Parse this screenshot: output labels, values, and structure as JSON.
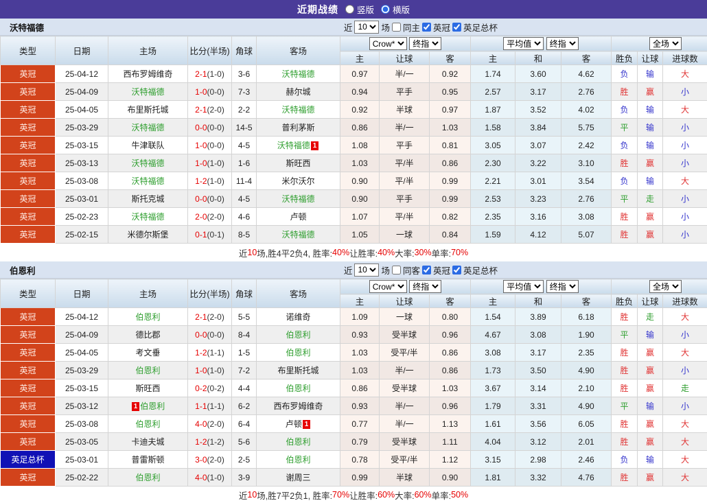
{
  "title_bar": {
    "title": "近期战绩",
    "vertical": "竖版",
    "horizontal": "横版"
  },
  "colors": {
    "titlebar_purple": "#4a3c99",
    "league_orange": "#d2431b",
    "cup_blue": "#1111b5",
    "focal_team_green": "#2e9e2e",
    "score_red": "#e60000",
    "win_red": "#e03333",
    "loss_blue": "#3333cc",
    "draw_green": "#2e9e2e"
  },
  "type_styles": {
    "英冠": "league",
    "英足总杯": "cup"
  },
  "value_colors": {
    "胜": "red",
    "赢": "red",
    "大": "red",
    "负": "blue",
    "输": "blue",
    "小": "blue",
    "平": "green",
    "走": "green"
  },
  "table_header": {
    "type": "类型",
    "date": "日期",
    "home": "主场",
    "score": "比分(半场)",
    "corners": "角球",
    "away": "客场",
    "h_home": "主",
    "h_hcp": "让球",
    "h_away": "客",
    "a_home": "主",
    "a_draw": "和",
    "a_away": "客",
    "r_wl": "胜负",
    "r_hcp": "让球",
    "r_goals": "进球数"
  },
  "sections": [
    {
      "team": "沃特福德",
      "filter": {
        "near": "近",
        "count": "10",
        "matches": "场",
        "same": "同主",
        "league1": "英冠",
        "league2": "英足总杯"
      },
      "selects": {
        "source": "Crow*",
        "time1": "终指",
        "avg": "平均值",
        "time2": "终指",
        "scope": "全场"
      },
      "rows": [
        {
          "type": "英冠",
          "date": "25-04-12",
          "home": "西布罗姆维奇",
          "score": "2-1",
          "half": "(1-0)",
          "corners": "3-6",
          "away": "沃特福德",
          "ag": 1,
          "o1": "0.97",
          "hcp": "半/一",
          "o2": "0.92",
          "a1": "1.74",
          "a2": "3.60",
          "a3": "4.62",
          "r": "负",
          "hr": "输",
          "g": "大"
        },
        {
          "type": "英冠",
          "date": "25-04-09",
          "home": "沃特福德",
          "hg": 1,
          "score": "1-0",
          "half": "(0-0)",
          "corners": "7-3",
          "away": "赫尔城",
          "o1": "0.94",
          "hcp": "平手",
          "o2": "0.95",
          "a1": "2.57",
          "a2": "3.17",
          "a3": "2.76",
          "r": "胜",
          "hr": "赢",
          "g": "小"
        },
        {
          "type": "英冠",
          "date": "25-04-05",
          "home": "布里斯托城",
          "score": "2-1",
          "half": "(2-0)",
          "corners": "2-2",
          "away": "沃特福德",
          "ag": 1,
          "o1": "0.92",
          "hcp": "半球",
          "o2": "0.97",
          "a1": "1.87",
          "a2": "3.52",
          "a3": "4.02",
          "r": "负",
          "hr": "输",
          "g": "大"
        },
        {
          "type": "英冠",
          "date": "25-03-29",
          "home": "沃特福德",
          "hg": 1,
          "score": "0-0",
          "half": "(0-0)",
          "corners": "14-5",
          "away": "普利茅斯",
          "o1": "0.86",
          "hcp": "半/一",
          "o2": "1.03",
          "a1": "1.58",
          "a2": "3.84",
          "a3": "5.75",
          "r": "平",
          "hr": "输",
          "g": "小"
        },
        {
          "type": "英冠",
          "date": "25-03-15",
          "home": "牛津联队",
          "score": "1-0",
          "half": "(0-0)",
          "corners": "4-5",
          "away": "沃特福德",
          "ag": 1,
          "aba": "1",
          "o1": "1.08",
          "hcp": "平手",
          "o2": "0.81",
          "a1": "3.05",
          "a2": "3.07",
          "a3": "2.42",
          "r": "负",
          "hr": "输",
          "g": "小"
        },
        {
          "type": "英冠",
          "date": "25-03-13",
          "home": "沃特福德",
          "hg": 1,
          "score": "1-0",
          "half": "(1-0)",
          "corners": "1-6",
          "away": "斯旺西",
          "o1": "1.03",
          "hcp": "平/半",
          "o2": "0.86",
          "a1": "2.30",
          "a2": "3.22",
          "a3": "3.10",
          "r": "胜",
          "hr": "赢",
          "g": "小"
        },
        {
          "type": "英冠",
          "date": "25-03-08",
          "home": "沃特福德",
          "hg": 1,
          "score": "1-2",
          "half": "(1-0)",
          "corners": "11-4",
          "away": "米尔沃尔",
          "o1": "0.90",
          "hcp": "平/半",
          "o2": "0.99",
          "a1": "2.21",
          "a2": "3.01",
          "a3": "3.54",
          "r": "负",
          "hr": "输",
          "g": "大"
        },
        {
          "type": "英冠",
          "date": "25-03-01",
          "home": "斯托克城",
          "score": "0-0",
          "half": "(0-0)",
          "corners": "4-5",
          "away": "沃特福德",
          "ag": 1,
          "o1": "0.90",
          "hcp": "平手",
          "o2": "0.99",
          "a1": "2.53",
          "a2": "3.23",
          "a3": "2.76",
          "r": "平",
          "hr": "走",
          "g": "小"
        },
        {
          "type": "英冠",
          "date": "25-02-23",
          "home": "沃特福德",
          "hg": 1,
          "score": "2-0",
          "half": "(2-0)",
          "corners": "4-6",
          "away": "卢顿",
          "o1": "1.07",
          "hcp": "平/半",
          "o2": "0.82",
          "a1": "2.35",
          "a2": "3.16",
          "a3": "3.08",
          "r": "胜",
          "hr": "赢",
          "g": "小"
        },
        {
          "type": "英冠",
          "date": "25-02-15",
          "home": "米德尔斯堡",
          "score": "0-1",
          "half": "(0-1)",
          "corners": "8-5",
          "away": "沃特福德",
          "ag": 1,
          "o1": "1.05",
          "hcp": "一球",
          "o2": "0.84",
          "a1": "1.59",
          "a2": "4.12",
          "a3": "5.07",
          "r": "胜",
          "hr": "赢",
          "g": "小"
        }
      ],
      "summary": {
        "s1": "近",
        "s2": "10",
        "s3": "场,胜4平2负4, 胜率:",
        "s4": "40%",
        "s5": " 让胜率:",
        "s6": "40%",
        "s7": " 大率:",
        "s8": "30%",
        "s9": " 单率:",
        "s10": "70%"
      }
    },
    {
      "team": "伯恩利",
      "filter": {
        "near": "近",
        "count": "10",
        "matches": "场",
        "same": "同客",
        "league1": "英冠",
        "league2": "英足总杯"
      },
      "selects": {
        "source": "Crow*",
        "time1": "终指",
        "avg": "平均值",
        "time2": "终指",
        "scope": "全场"
      },
      "rows": [
        {
          "type": "英冠",
          "date": "25-04-12",
          "home": "伯恩利",
          "hg": 1,
          "score": "2-1",
          "half": "(2-0)",
          "corners": "5-5",
          "away": "诺维奇",
          "o1": "1.09",
          "hcp": "一球",
          "o2": "0.80",
          "a1": "1.54",
          "a2": "3.89",
          "a3": "6.18",
          "r": "胜",
          "hr": "走",
          "g": "大"
        },
        {
          "type": "英冠",
          "date": "25-04-09",
          "home": "德比郡",
          "score": "0-0",
          "half": "(0-0)",
          "corners": "8-4",
          "away": "伯恩利",
          "ag": 1,
          "o1": "0.93",
          "hcp": "受半球",
          "o2": "0.96",
          "a1": "4.67",
          "a2": "3.08",
          "a3": "1.90",
          "r": "平",
          "hr": "输",
          "g": "小"
        },
        {
          "type": "英冠",
          "date": "25-04-05",
          "home": "考文垂",
          "score": "1-2",
          "half": "(1-1)",
          "corners": "1-5",
          "away": "伯恩利",
          "ag": 1,
          "o1": "1.03",
          "hcp": "受平/半",
          "o2": "0.86",
          "a1": "3.08",
          "a2": "3.17",
          "a3": "2.35",
          "r": "胜",
          "hr": "赢",
          "g": "大"
        },
        {
          "type": "英冠",
          "date": "25-03-29",
          "home": "伯恩利",
          "hg": 1,
          "score": "1-0",
          "half": "(1-0)",
          "corners": "7-2",
          "away": "布里斯托城",
          "o1": "1.03",
          "hcp": "半/一",
          "o2": "0.86",
          "a1": "1.73",
          "a2": "3.50",
          "a3": "4.90",
          "r": "胜",
          "hr": "赢",
          "g": "小"
        },
        {
          "type": "英冠",
          "date": "25-03-15",
          "home": "斯旺西",
          "score": "0-2",
          "half": "(0-2)",
          "corners": "4-4",
          "away": "伯恩利",
          "ag": 1,
          "o1": "0.86",
          "hcp": "受半球",
          "o2": "1.03",
          "a1": "3.67",
          "a2": "3.14",
          "a3": "2.10",
          "r": "胜",
          "hr": "赢",
          "g": "走"
        },
        {
          "type": "英冠",
          "date": "25-03-12",
          "home": "伯恩利",
          "hg": 1,
          "hbb": "1",
          "score": "1-1",
          "half": "(1-1)",
          "corners": "6-2",
          "away": "西布罗姆维奇",
          "o1": "0.93",
          "hcp": "半/一",
          "o2": "0.96",
          "a1": "1.79",
          "a2": "3.31",
          "a3": "4.90",
          "r": "平",
          "hr": "输",
          "g": "小"
        },
        {
          "type": "英冠",
          "date": "25-03-08",
          "home": "伯恩利",
          "hg": 1,
          "score": "4-0",
          "half": "(2-0)",
          "corners": "6-4",
          "away": "卢顿",
          "aba": "1",
          "o1": "0.77",
          "hcp": "半/一",
          "o2": "1.13",
          "a1": "1.61",
          "a2": "3.56",
          "a3": "6.05",
          "r": "胜",
          "hr": "赢",
          "g": "大"
        },
        {
          "type": "英冠",
          "date": "25-03-05",
          "home": "卡迪夫城",
          "score": "1-2",
          "half": "(1-2)",
          "corners": "5-6",
          "away": "伯恩利",
          "ag": 1,
          "o1": "0.79",
          "hcp": "受半球",
          "o2": "1.11",
          "a1": "4.04",
          "a2": "3.12",
          "a3": "2.01",
          "r": "胜",
          "hr": "赢",
          "g": "大"
        },
        {
          "type": "英足总杯",
          "date": "25-03-01",
          "home": "普雷斯顿",
          "score": "3-0",
          "half": "(2-0)",
          "corners": "2-5",
          "away": "伯恩利",
          "ag": 1,
          "o1": "0.78",
          "hcp": "受平/半",
          "o2": "1.12",
          "a1": "3.15",
          "a2": "2.98",
          "a3": "2.46",
          "r": "负",
          "hr": "输",
          "g": "大"
        },
        {
          "type": "英冠",
          "date": "25-02-22",
          "home": "伯恩利",
          "hg": 1,
          "score": "4-0",
          "half": "(1-0)",
          "corners": "3-9",
          "away": "谢周三",
          "o1": "0.99",
          "hcp": "半球",
          "o2": "0.90",
          "a1": "1.81",
          "a2": "3.32",
          "a3": "4.76",
          "r": "胜",
          "hr": "赢",
          "g": "大"
        }
      ],
      "summary": {
        "s1": "近",
        "s2": "10",
        "s3": "场,胜7平2负1, 胜率:",
        "s4": "70%",
        "s5": " 让胜率:",
        "s6": "60%",
        "s7": " 大率:",
        "s8": "60%",
        "s9": " 单率:",
        "s10": "50%"
      }
    }
  ]
}
